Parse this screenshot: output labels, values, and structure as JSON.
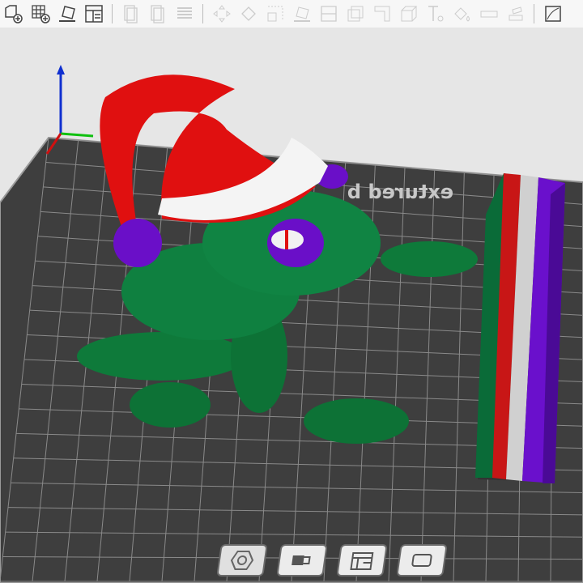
{
  "toolbar": {
    "groups": [
      [
        "add-icon",
        "arrange-icon",
        "auto-orient-icon",
        "layout-icon"
      ],
      [
        "copy-icon",
        "paste-icon",
        "layers-icon"
      ],
      [
        "move-icon",
        "rotate-icon",
        "scale-icon",
        "place-on-face-icon",
        "cut-icon",
        "hollow-icon",
        "support-paint-icon",
        "seam-paint-icon",
        "text-icon",
        "mmu-paint-icon",
        "measure-icon",
        "emboss-icon"
      ],
      [
        "variable-layer-icon"
      ]
    ]
  },
  "bed": {
    "texture_label": "extured b",
    "colors": {
      "bed": "#3e3e3e",
      "grid": "#8a8a8a",
      "background": "#e6e6e6"
    }
  },
  "model": {
    "colors": {
      "frog": "#0e7a3a",
      "hat": "#e01010",
      "trim": "#f4f4f4",
      "pompom": "#6a0fc8"
    }
  },
  "wipe_tower": {
    "stripes": [
      "#0a6b38",
      "#c81616",
      "#d0d0d0",
      "#6a10cc"
    ]
  },
  "bottom_bar": {
    "buttons": [
      "settings-icon",
      "toggle-view-icon",
      "slice-preview-icon",
      "more-icon"
    ]
  }
}
